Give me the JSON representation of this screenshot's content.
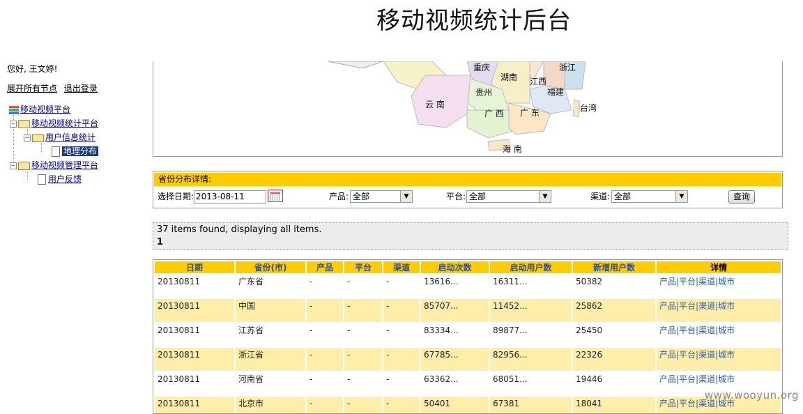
{
  "app_title": "移动视频统计后台",
  "sidebar": {
    "greeting": "您好, 王文婷!",
    "expand_all": "展开所有节点",
    "logout": "退出登录",
    "tree": {
      "root": "移动视频平台",
      "stats_platform": "移动视频统计平台",
      "user_info_stats": "用户信息统计",
      "region_dist": "地理分布",
      "manage_platform": "移动视频管理平台",
      "user_feedback": "用户反馈"
    }
  },
  "map": {
    "labels": [
      "重庆",
      "浙江",
      "湖南",
      "江西",
      "福建",
      "贵州",
      "台湾",
      "云 南",
      "广 西",
      "广 东",
      "海 南"
    ]
  },
  "filter": {
    "header": "省份分布详情:",
    "date_label": "选择日期:",
    "date_value": "2013-08-11",
    "product_label": "产品:",
    "product_value": "全部",
    "platform_label": "平台:",
    "platform_value": "全部",
    "channel_label": "渠道:",
    "channel_value": "全部",
    "query_button": "查询"
  },
  "results": {
    "summary": "37 items found, displaying all items.",
    "page": "1"
  },
  "table": {
    "headers": [
      "日期",
      "省份(市)",
      "产品",
      "平台",
      "渠道",
      "启动次数",
      "启动用户数",
      "新增用户数",
      "详情"
    ],
    "rows": [
      [
        "20130811",
        "广东省",
        "-",
        "-",
        "-",
        "13616...",
        "16311...",
        "50382",
        "产品|平台|渠道|城市"
      ],
      [
        "20130811",
        "中国",
        "-",
        "-",
        "-",
        "85707...",
        "11452...",
        "25862",
        "产品|平台|渠道|城市"
      ],
      [
        "20130811",
        "江苏省",
        "-",
        "-",
        "-",
        "83334...",
        "89877...",
        "25450",
        "产品|平台|渠道|城市"
      ],
      [
        "20130811",
        "浙江省",
        "-",
        "-",
        "-",
        "67785...",
        "82956...",
        "22326",
        "产品|平台|渠道|城市"
      ],
      [
        "20130811",
        "河南省",
        "-",
        "-",
        "-",
        "63362...",
        "68051...",
        "19446",
        "产品|平台|渠道|城市"
      ],
      [
        "20130811",
        "北京市",
        "-",
        "-",
        "-",
        "50401",
        "67381",
        "18041",
        "产品|平台|渠道|城市"
      ]
    ]
  },
  "watermark": "www.wooyun.org"
}
